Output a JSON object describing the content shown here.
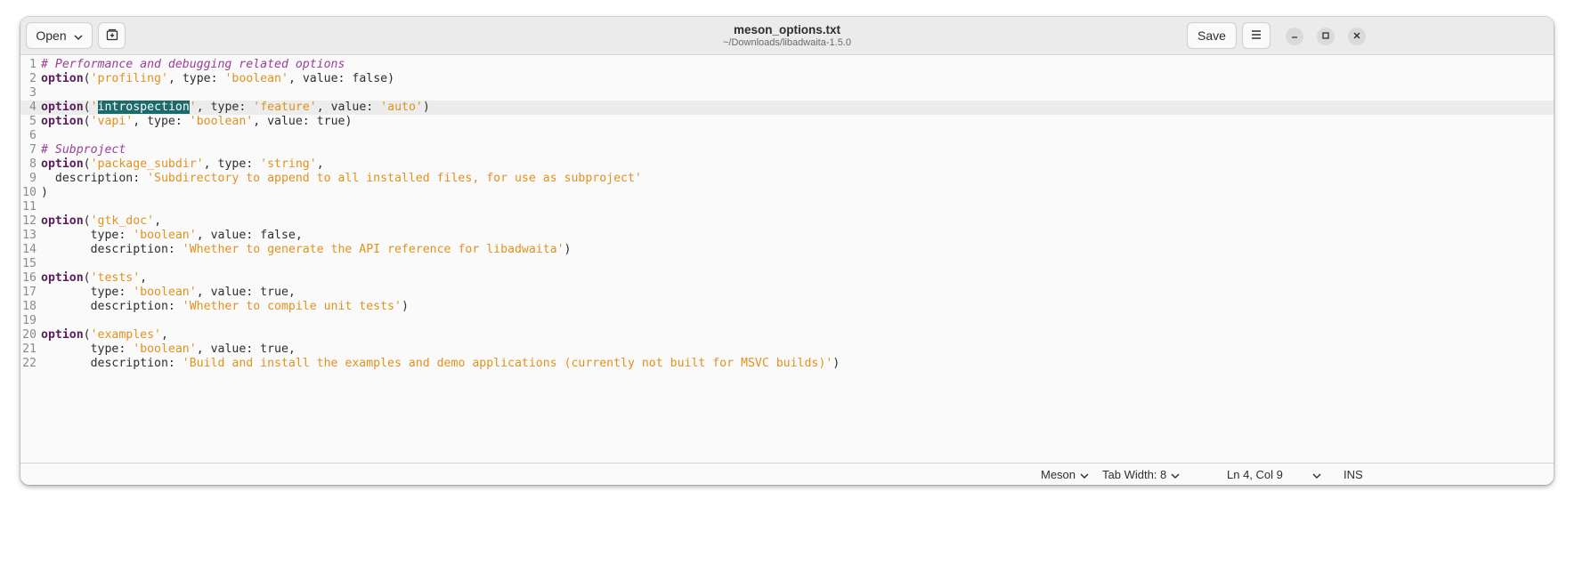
{
  "header": {
    "open_label": "Open",
    "save_label": "Save",
    "title": "meson_options.txt",
    "subtitle": "~/Downloads/libadwaita-1.5.0"
  },
  "icons": {
    "open_dropdown": "chevron-down-icon",
    "new_tab": "new-tab-icon",
    "menu": "hamburger-menu-icon",
    "minimize": "minimize-icon",
    "maximize": "maximize-icon",
    "close": "close-icon"
  },
  "editor": {
    "current_line": 4,
    "lines": [
      {
        "n": "1",
        "tokens": [
          {
            "t": "# Performance and debugging related options",
            "c": "cm"
          }
        ]
      },
      {
        "n": "2",
        "tokens": [
          {
            "t": "option",
            "c": "kw"
          },
          {
            "t": "(",
            "c": ""
          },
          {
            "t": "'profiling'",
            "c": "str"
          },
          {
            "t": ", type: ",
            "c": ""
          },
          {
            "t": "'boolean'",
            "c": "str"
          },
          {
            "t": ", value: false)",
            "c": ""
          }
        ]
      },
      {
        "n": "3",
        "tokens": []
      },
      {
        "n": "4",
        "tokens": [
          {
            "t": "option",
            "c": "kw"
          },
          {
            "t": "(",
            "c": ""
          },
          {
            "t": "'",
            "c": "str"
          },
          {
            "t": "introspection",
            "c": "sel"
          },
          {
            "t": "'",
            "c": "str"
          },
          {
            "t": ", type: ",
            "c": ""
          },
          {
            "t": "'feature'",
            "c": "str"
          },
          {
            "t": ", value: ",
            "c": ""
          },
          {
            "t": "'auto'",
            "c": "str"
          },
          {
            "t": ")",
            "c": ""
          }
        ]
      },
      {
        "n": "5",
        "tokens": [
          {
            "t": "option",
            "c": "kw"
          },
          {
            "t": "(",
            "c": ""
          },
          {
            "t": "'vapi'",
            "c": "str"
          },
          {
            "t": ", type: ",
            "c": ""
          },
          {
            "t": "'boolean'",
            "c": "str"
          },
          {
            "t": ", value: true)",
            "c": ""
          }
        ]
      },
      {
        "n": "6",
        "tokens": []
      },
      {
        "n": "7",
        "tokens": [
          {
            "t": "# Subproject",
            "c": "cm"
          }
        ]
      },
      {
        "n": "8",
        "tokens": [
          {
            "t": "option",
            "c": "kw"
          },
          {
            "t": "(",
            "c": ""
          },
          {
            "t": "'package_subdir'",
            "c": "str"
          },
          {
            "t": ", type: ",
            "c": ""
          },
          {
            "t": "'string'",
            "c": "str"
          },
          {
            "t": ",",
            "c": ""
          }
        ]
      },
      {
        "n": "9",
        "tokens": [
          {
            "t": "  description: ",
            "c": ""
          },
          {
            "t": "'Subdirectory to append to all installed files, for use as subproject'",
            "c": "str"
          }
        ]
      },
      {
        "n": "10",
        "tokens": [
          {
            "t": ")",
            "c": ""
          }
        ]
      },
      {
        "n": "11",
        "tokens": []
      },
      {
        "n": "12",
        "tokens": [
          {
            "t": "option",
            "c": "kw"
          },
          {
            "t": "(",
            "c": ""
          },
          {
            "t": "'gtk_doc'",
            "c": "str"
          },
          {
            "t": ",",
            "c": ""
          }
        ]
      },
      {
        "n": "13",
        "tokens": [
          {
            "t": "       type: ",
            "c": ""
          },
          {
            "t": "'boolean'",
            "c": "str"
          },
          {
            "t": ", value: false,",
            "c": ""
          }
        ]
      },
      {
        "n": "14",
        "tokens": [
          {
            "t": "       description: ",
            "c": ""
          },
          {
            "t": "'Whether to generate the API reference for libadwaita'",
            "c": "str"
          },
          {
            "t": ")",
            "c": ""
          }
        ]
      },
      {
        "n": "15",
        "tokens": []
      },
      {
        "n": "16",
        "tokens": [
          {
            "t": "option",
            "c": "kw"
          },
          {
            "t": "(",
            "c": ""
          },
          {
            "t": "'tests'",
            "c": "str"
          },
          {
            "t": ",",
            "c": ""
          }
        ]
      },
      {
        "n": "17",
        "tokens": [
          {
            "t": "       type: ",
            "c": ""
          },
          {
            "t": "'boolean'",
            "c": "str"
          },
          {
            "t": ", value: true,",
            "c": ""
          }
        ]
      },
      {
        "n": "18",
        "tokens": [
          {
            "t": "       description: ",
            "c": ""
          },
          {
            "t": "'Whether to compile unit tests'",
            "c": "str"
          },
          {
            "t": ")",
            "c": ""
          }
        ]
      },
      {
        "n": "19",
        "tokens": []
      },
      {
        "n": "20",
        "tokens": [
          {
            "t": "option",
            "c": "kw"
          },
          {
            "t": "(",
            "c": ""
          },
          {
            "t": "'examples'",
            "c": "str"
          },
          {
            "t": ",",
            "c": ""
          }
        ]
      },
      {
        "n": "21",
        "tokens": [
          {
            "t": "       type: ",
            "c": ""
          },
          {
            "t": "'boolean'",
            "c": "str"
          },
          {
            "t": ", value: true,",
            "c": ""
          }
        ]
      },
      {
        "n": "22",
        "tokens": [
          {
            "t": "       description: ",
            "c": ""
          },
          {
            "t": "'Build and install the examples and demo applications (currently not built for MSVC builds)'",
            "c": "str"
          },
          {
            "t": ")",
            "c": ""
          }
        ]
      }
    ]
  },
  "statusbar": {
    "language": "Meson",
    "tab_width": "Tab Width: 8",
    "position": "Ln 4, Col 9",
    "mode": "INS"
  },
  "colors": {
    "keyword": "#5a1d5a",
    "string": "#e0921e",
    "comment": "#9a3e9a",
    "selection": "#1b6b6b"
  }
}
